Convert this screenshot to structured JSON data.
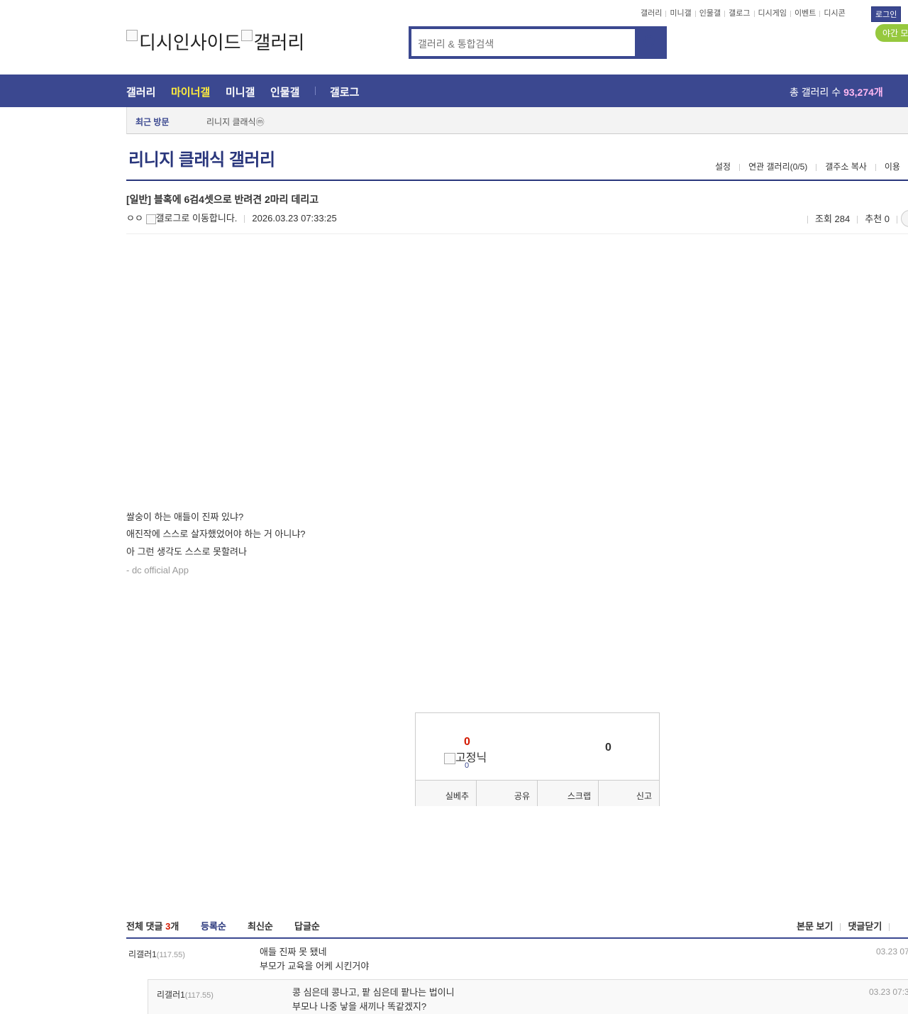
{
  "util_menu": [
    "갤러리",
    "미니갤",
    "인물갤",
    "갤로그",
    "디시게임",
    "이벤트",
    "디시콘"
  ],
  "login_label": "로그인",
  "night_mode_label": "야간 모드",
  "logo": {
    "site_alt": "디시인사이드",
    "section_alt": "갤러리"
  },
  "search": {
    "placeholder": "갤러리 & 통합검색"
  },
  "gnb": {
    "items": [
      "갤러리",
      "마이너갤",
      "미니갤",
      "인물갤"
    ],
    "gallog": "갤로그",
    "total_label": "총 갤러리 수",
    "total_value": "93,274개"
  },
  "recent_visit": {
    "label": "최근 방문",
    "gallery": "리니지 클래식ⓜ"
  },
  "gallery": {
    "title": "리니지 클래식 갤러리",
    "tools": [
      "설정",
      "연관 갤러리(0/5)",
      "갤주소 복사",
      "이용"
    ]
  },
  "post": {
    "title": "[일반] 블혹에 6검4셋으로 반려견 2마리 데리고",
    "writer": "ㅇㅇ",
    "gallog_alt": "갤로그로 이동합니다.",
    "date": "2026.03.23 07:33:25",
    "views_label": "조회 284",
    "recommend_label": "추천 0",
    "lines": [
      "쌀숭이 하는 애들이 진짜 있냐?",
      "애진작에 스스로 살자했었어야 하는 거 아니냐?",
      "아 그런 생각도 스스로 못할려나"
    ],
    "app_sig": "- dc official App"
  },
  "recommend": {
    "up_count": "0",
    "fixed_alt": "고정닉",
    "fixed_count": "0",
    "down_count": "0",
    "buttons": [
      "실베추",
      "공유",
      "스크랩",
      "신고"
    ]
  },
  "comments": {
    "total_label": "전체 댓글",
    "total_count": "3",
    "unit": "개",
    "sorts": [
      "등록순",
      "최신순",
      "답글순"
    ],
    "tools": [
      "본문 보기",
      "댓글닫기"
    ],
    "items": [
      {
        "nick": "리갤러1",
        "ip": "(117.55)",
        "line1": "애들 진짜 못 됐네",
        "line2": "부모가 교육을 어케 시킨거야",
        "date": "03.23 07:"
      },
      {
        "nick": "리갤러1",
        "ip": "(117.55)",
        "line1": "콩 심은데 콩나고, 팥 심은데 팥나는 법이니",
        "line2": "부모나 나중 낳을 새끼나 똑같겠지?",
        "date": "03.23 07:3"
      }
    ]
  }
}
